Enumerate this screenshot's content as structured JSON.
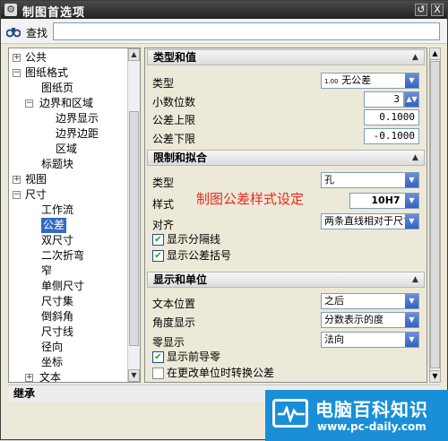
{
  "window": {
    "title": "制图首选项",
    "title_icon": "gear-icon",
    "restore_btn": "↺",
    "close_btn": "X"
  },
  "search": {
    "label": "查找",
    "icon": "binoculars-icon",
    "value": ""
  },
  "tree": [
    {
      "label": "公共",
      "expander": "+",
      "selected": false
    },
    {
      "label": "图纸格式",
      "expander": "-",
      "selected": false
    },
    {
      "label": "图纸页",
      "expander": "",
      "selected": false
    },
    {
      "label": "边界和区域",
      "expander": "-",
      "selected": false
    },
    {
      "label": "边界显示",
      "expander": "",
      "selected": false
    },
    {
      "label": "边界边距",
      "expander": "",
      "selected": false
    },
    {
      "label": "区域",
      "expander": "",
      "selected": false
    },
    {
      "label": "标题块",
      "expander": "",
      "selected": false
    },
    {
      "label": "视图",
      "expander": "+",
      "selected": false
    },
    {
      "label": "尺寸",
      "expander": "-",
      "selected": false
    },
    {
      "label": "工作流",
      "expander": "",
      "selected": false
    },
    {
      "label": "公差",
      "expander": "",
      "selected": true
    },
    {
      "label": "双尺寸",
      "expander": "",
      "selected": false
    },
    {
      "label": "二次折弯",
      "expander": "",
      "selected": false
    },
    {
      "label": "窄",
      "expander": "",
      "selected": false
    },
    {
      "label": "单侧尺寸",
      "expander": "",
      "selected": false
    },
    {
      "label": "尺寸集",
      "expander": "",
      "selected": false
    },
    {
      "label": "倒斜角",
      "expander": "",
      "selected": false
    },
    {
      "label": "尺寸线",
      "expander": "",
      "selected": false
    },
    {
      "label": "径向",
      "expander": "",
      "selected": false
    },
    {
      "label": "坐标",
      "expander": "",
      "selected": false
    },
    {
      "label": "文本",
      "expander": "+",
      "selected": false
    }
  ],
  "sections": {
    "type_value": {
      "title": "类型和值",
      "type_label": "类型",
      "type_value": "无公差",
      "type_badge": "1.00",
      "decimals_label": "小数位数",
      "decimals_value": "3",
      "upper_label": "公差上限",
      "upper_value": "0.1000",
      "lower_label": "公差下限",
      "lower_value": "-0.1000"
    },
    "limits_fits": {
      "title": "限制和拟合",
      "type_label": "类型",
      "type_value": "孔",
      "style_label": "样式",
      "style_value": "10H7",
      "align_label": "对齐",
      "align_value": "两条直线相对于尺寸",
      "show_separator": "显示分隔线",
      "show_separator_checked": true,
      "show_brackets": "显示公差括号",
      "show_brackets_checked": true
    },
    "display_units": {
      "title": "显示和单位",
      "text_pos_label": "文本位置",
      "text_pos_value": "之后",
      "angle_label": "角度显示",
      "angle_value": "分数表示的度",
      "zero_label": "零显示",
      "zero_value": "法向",
      "leading_zero": "显示前导零",
      "leading_zero_checked": true,
      "convert_units": "在更改单位时转换公差",
      "convert_units_checked": false
    }
  },
  "annotation": "制图公差样式设定",
  "inherit_label": "继承",
  "watermark": {
    "title": "电脑百科知识",
    "url": "www.pc-daily.com"
  }
}
